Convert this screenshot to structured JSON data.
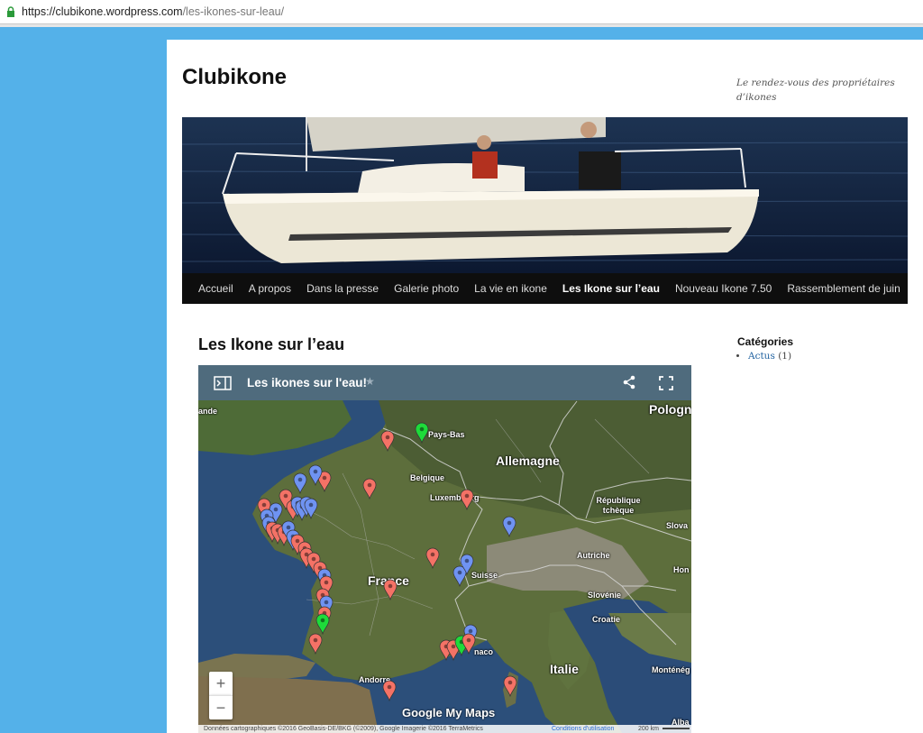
{
  "browser": {
    "url_host": "https://clubikone.wordpress.com",
    "url_path": "/les-ikones-sur-leau/"
  },
  "site": {
    "title": "Clubikone",
    "tagline": "Le rendez-vous des propriétaires d’ikones"
  },
  "nav": {
    "items": [
      "Accueil",
      "A propos",
      "Dans la presse",
      "Galerie photo",
      "La vie en ikone",
      "Les Ikone sur l’eau",
      "Nouveau Ikone 7.50",
      "Rassemblement de juin"
    ],
    "active_index": 5
  },
  "entry": {
    "title": "Les Ikone sur l’eau"
  },
  "sidebar": {
    "heading": "Catégories",
    "link": "Actus",
    "count": "(1)"
  },
  "map": {
    "title": "Les ikones sur l'eau!",
    "zoom_in": "+",
    "zoom_out": "−",
    "logo": "Google My Maps",
    "attribution": "Données cartographiques ©2016 GeoBasis-DE/BKG (©2009), Google Imagerie ©2016 TerraMetrics",
    "terms": "Conditions d'utilisation",
    "scale": "200 km",
    "labels": {
      "pologne": "Pologn",
      "pays_bas": "Pays-Bas",
      "allemagne": "Allemagne",
      "belgique": "Belgique",
      "luxembourg": "Luxembourg",
      "republique_tcheque": "République tchèque",
      "slova": "Slova",
      "autriche": "Autriche",
      "hong": "Hon",
      "suisse": "Suisse",
      "france": "France",
      "slovenie": "Slovénie",
      "croatie": "Croatie",
      "monaco": "naco",
      "italie": "Italie",
      "montenegro": "Monténég",
      "andorre": "Andorre",
      "alba": "Alba",
      "irlande": "ande"
    },
    "colors": {
      "red": "#f47266",
      "blue": "#6f93f2",
      "green": "#1edb3a"
    }
  }
}
